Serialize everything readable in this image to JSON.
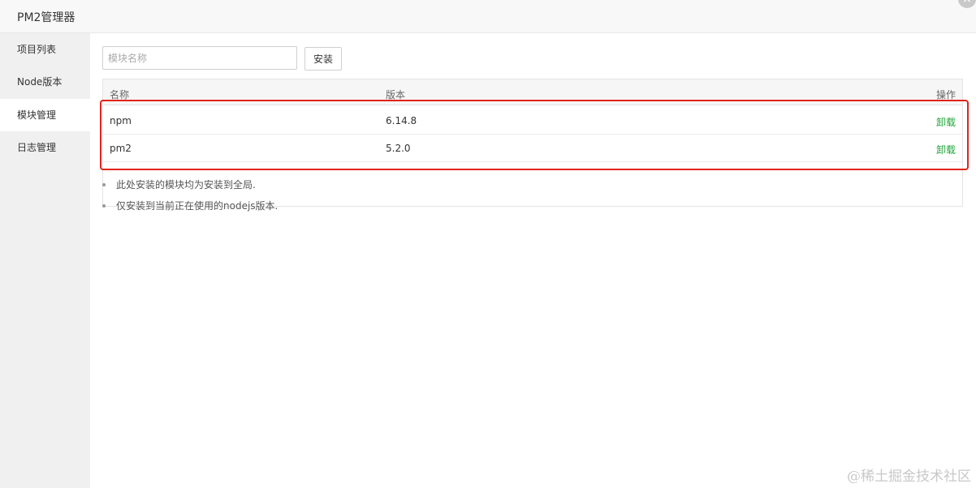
{
  "window": {
    "title": "PM2管理器"
  },
  "sidebar": {
    "items": [
      {
        "label": "项目列表",
        "active": false
      },
      {
        "label": "Node版本",
        "active": false
      },
      {
        "label": "模块管理",
        "active": true
      },
      {
        "label": "日志管理",
        "active": false
      }
    ]
  },
  "search": {
    "placeholder": "模块名称",
    "value": "",
    "install_label": "安装"
  },
  "table": {
    "headers": [
      "名称",
      "版本",
      "操作"
    ],
    "rows": [
      {
        "name": "npm",
        "version": "6.14.8",
        "action": "卸载"
      },
      {
        "name": "pm2",
        "version": "5.2.0",
        "action": "卸载"
      }
    ]
  },
  "notes": [
    "此处安装的模块均为安装到全局.",
    "仅安装到当前正在使用的nodejs版本."
  ],
  "watermark": "@稀土掘金技术社区",
  "colors": {
    "action": "#20a53a",
    "highlight": "#e2231a",
    "sidebar_bg": "#f0f0f0"
  }
}
